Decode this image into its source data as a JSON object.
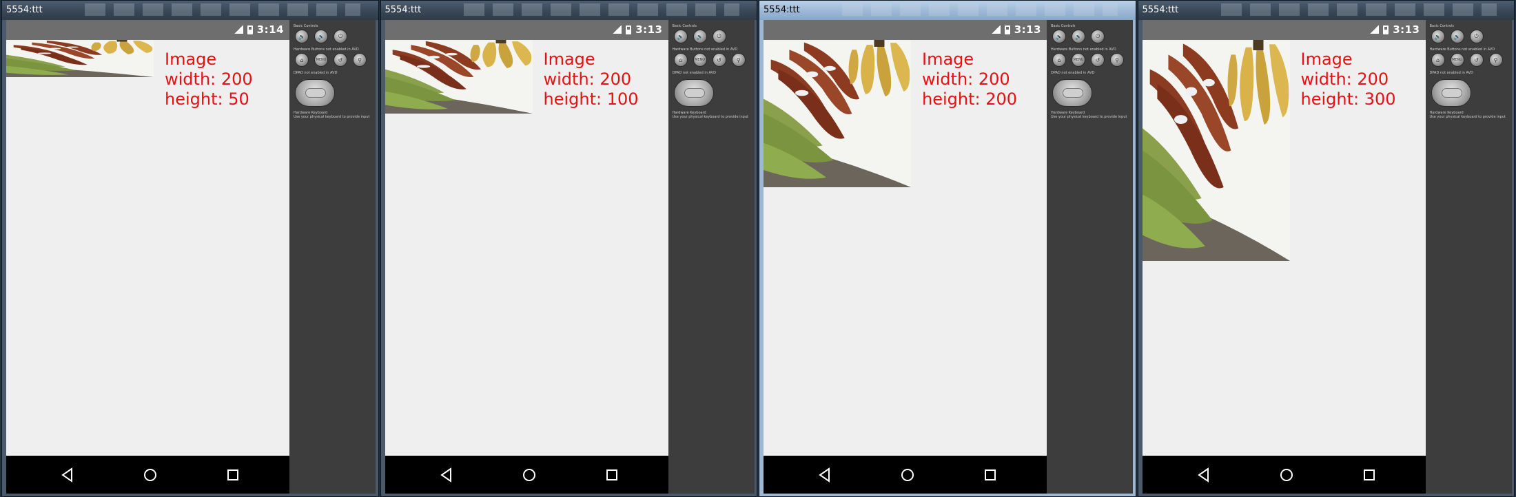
{
  "windows": [
    {
      "title": "5554:ttt",
      "clock": "3:14",
      "label_line1": "Image",
      "label_line2": "width: 200",
      "label_line3": "height: 50",
      "image_height_value": 50
    },
    {
      "title": "5554:ttt",
      "clock": "3:13",
      "label_line1": "Image",
      "label_line2": "width: 200",
      "label_line3": "height: 100",
      "image_height_value": 100
    },
    {
      "title": "5554:ttt",
      "clock": "3:13",
      "label_line1": "Image",
      "label_line2": "width: 200",
      "label_line3": "height: 200",
      "image_height_value": 200
    },
    {
      "title": "5554:ttt",
      "clock": "3:13",
      "label_line1": "Image",
      "label_line2": "width: 200",
      "label_line3": "height: 300",
      "image_height_value": 300
    }
  ],
  "controls": {
    "basic_controls": "Basic Controls",
    "hardware_buttons": "Hardware Buttons not enabled in AVD",
    "dpad": "DPAD not enabled in AVD",
    "hardware_keyboard": "Hardware Keyboard",
    "keyboard_hint": "Use your physical keyboard to provide input",
    "menu_label": "MENU"
  },
  "icons": {
    "nav": [
      "back-triangle-icon",
      "home-circle-icon",
      "recent-square-icon"
    ],
    "control_row1": [
      "volume-down-icon",
      "volume-up-icon",
      "power-icon"
    ],
    "control_row2": [
      "home-icon",
      "menu-icon",
      "rotate-icon",
      "search-icon"
    ]
  },
  "colors": {
    "label_red": "#e81010",
    "screen_bg": "#efefef",
    "status_bar": "#6e6e6e",
    "nav_bar": "#000000",
    "controls_bg": "#3d3d3d"
  }
}
